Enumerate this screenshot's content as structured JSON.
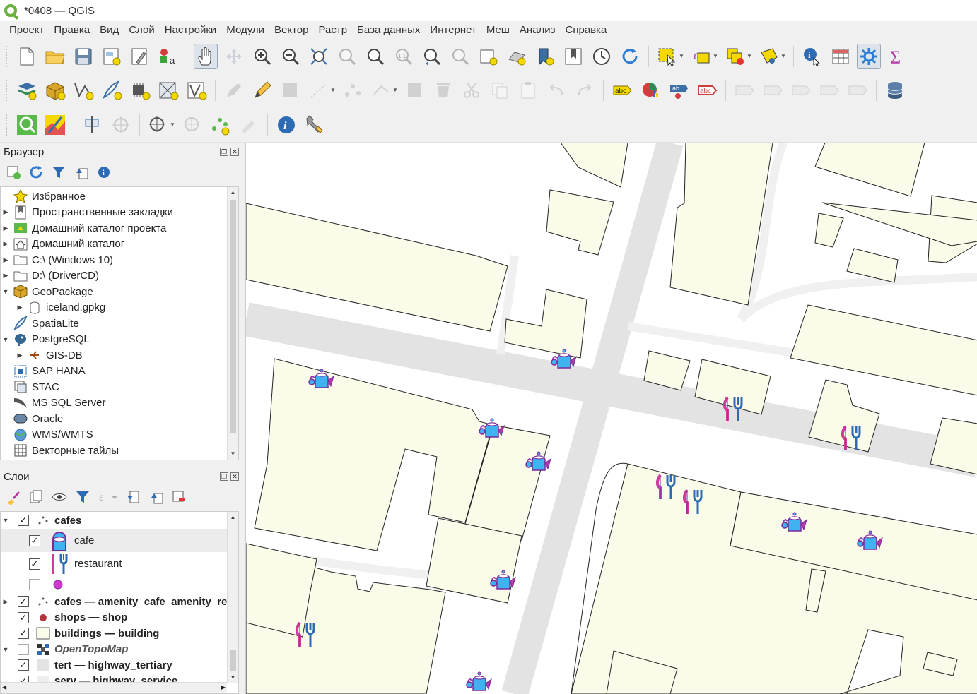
{
  "window": {
    "title": "*0408 — QGIS"
  },
  "menu": [
    "Проект",
    "Правка",
    "Вид",
    "Слой",
    "Настройки",
    "Модули",
    "Вектор",
    "Растр",
    "База данных",
    "Интернет",
    "Меш",
    "Анализ",
    "Справка"
  ],
  "browser": {
    "title": "Браузер",
    "items": [
      {
        "label": "Избранное",
        "icon": "star-icon",
        "expander": ""
      },
      {
        "label": "Пространственные закладки",
        "icon": "bookmark-icon",
        "expander": "▶"
      },
      {
        "label": "Домашний каталог проекта",
        "icon": "project-home-icon",
        "expander": "▶"
      },
      {
        "label": "Домашний каталог",
        "icon": "home-icon",
        "expander": "▶"
      },
      {
        "label": "C:\\ (Windows 10)",
        "icon": "folder-icon",
        "expander": "▶"
      },
      {
        "label": "D:\\ (DriverCD)",
        "icon": "folder-icon",
        "expander": "▶"
      },
      {
        "label": "GeoPackage",
        "icon": "geopackage-icon",
        "expander": "▼"
      },
      {
        "label": "iceland.gpkg",
        "icon": "database-icon",
        "expander": "▶",
        "indent": true
      },
      {
        "label": "SpatiaLite",
        "icon": "spatialite-icon",
        "expander": ""
      },
      {
        "label": "PostgreSQL",
        "icon": "postgresql-icon",
        "expander": "▼"
      },
      {
        "label": "GIS-DB",
        "icon": "connection-icon",
        "expander": "▶",
        "indent": true
      },
      {
        "label": "SAP HANA",
        "icon": "sap-hana-icon",
        "expander": ""
      },
      {
        "label": "STAC",
        "icon": "stac-icon",
        "expander": ""
      },
      {
        "label": "MS SQL Server",
        "icon": "mssql-icon",
        "expander": ""
      },
      {
        "label": "Oracle",
        "icon": "oracle-icon",
        "expander": ""
      },
      {
        "label": "WMS/WMTS",
        "icon": "globe-icon",
        "expander": ""
      },
      {
        "label": "Векторные тайлы",
        "icon": "vector-tiles-icon",
        "expander": ""
      }
    ]
  },
  "layers": {
    "title": "Слои",
    "items": [
      {
        "label": "cafes",
        "style": "bold under",
        "checked": true,
        "expander": "▼",
        "icon": "point-layer-icon",
        "level": 0
      },
      {
        "label": "cafe",
        "style": "",
        "checked": true,
        "expander": "",
        "icon": "teapot-icon",
        "level": 1
      },
      {
        "label": "restaurant",
        "style": "",
        "checked": true,
        "expander": "",
        "icon": "fork-knife-icon",
        "level": 1
      },
      {
        "label": "",
        "style": "",
        "checked": false,
        "expander": "",
        "icon": "purple-dot-icon",
        "level": 1
      },
      {
        "label": "cafes — amenity_cafe_amenity_res",
        "style": "bold",
        "checked": true,
        "expander": "▶",
        "icon": "point-layer-icon",
        "level": 0
      },
      {
        "label": "shops — shop",
        "style": "bold",
        "checked": true,
        "expander": "",
        "icon": "red-dot-icon",
        "level": 0
      },
      {
        "label": "buildings — building",
        "style": "bold",
        "checked": true,
        "expander": "",
        "icon": "polygon-fill-icon",
        "level": 0
      },
      {
        "label": "OpenTopoMap",
        "style": "bold italic",
        "checked": false,
        "expander": "▼",
        "icon": "raster-icon",
        "level": 0
      },
      {
        "label": "tert — highway_tertiary",
        "style": "bold",
        "checked": true,
        "expander": "",
        "icon": "line-gray-icon",
        "level": 0
      },
      {
        "label": "serv — highway_service",
        "style": "bold",
        "checked": true,
        "expander": "",
        "icon": "line-gray-icon",
        "level": 0
      }
    ]
  },
  "colors": {
    "building_fill": "#fbfbea",
    "road": "#e3e3e3",
    "cafe_icon": "#3fb3f0",
    "restaurant_icon": "#b43aa8",
    "accent_yellow": "#f5d800"
  }
}
